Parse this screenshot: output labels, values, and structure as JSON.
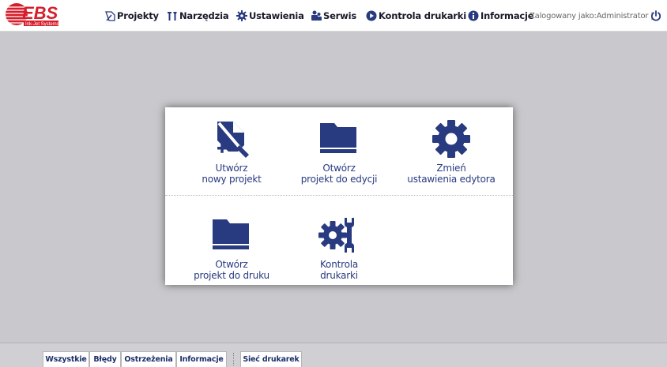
{
  "brand": {
    "logo_text": "EBS",
    "logo_subtext": "Ink-Jet Systems",
    "accent_color": "#d61d2b"
  },
  "nav": {
    "projekty": "Projekty",
    "narzedzia": "Narzędzia",
    "ustawienia": "Ustawienia",
    "serwis": "Serwis",
    "kontrola": "Kontrola drukarki",
    "informacje": "Informacje"
  },
  "user": {
    "login_text": "Zalogowany jako:Administrator |"
  },
  "tiles": {
    "new_project": "Utwórz\nnowy projekt",
    "open_edit": "Otwórz\nprojekt do edycji",
    "editor_settings": "Zmień\nustawienia edytora",
    "open_print": "Otwórz\nprojekt do druku",
    "printer_control": "Kontrola\ndrukarki"
  },
  "bottom_tabs": {
    "all": "Wszystkie",
    "errors": "Błędy",
    "warnings": "Ostrzeżenia",
    "info": "Informacje",
    "network": "Sieć drukarek"
  },
  "colors": {
    "icon_blue": "#283a80",
    "background": "#c9c9cd"
  }
}
